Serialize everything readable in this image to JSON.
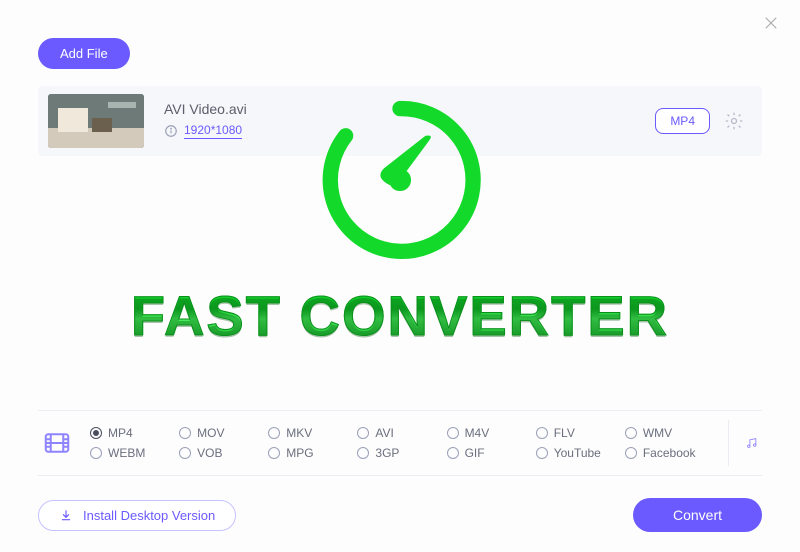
{
  "header": {
    "add_file_label": "Add File"
  },
  "file": {
    "name": "AVI Video.avi",
    "resolution": "1920*1080",
    "output_badge": "MP4"
  },
  "hero": {
    "title": "FAST CONVERTER"
  },
  "formats": {
    "selected": "MP4",
    "row1": [
      "MP4",
      "MOV",
      "MKV",
      "AVI",
      "M4V",
      "FLV",
      "WMV"
    ],
    "row2": [
      "WEBM",
      "VOB",
      "MPG",
      "3GP",
      "GIF",
      "YouTube",
      "Facebook"
    ]
  },
  "footer": {
    "install_label": "Install Desktop Version",
    "convert_label": "Convert"
  },
  "colors": {
    "primary": "#6a5aff",
    "accent": "#14d62a"
  }
}
